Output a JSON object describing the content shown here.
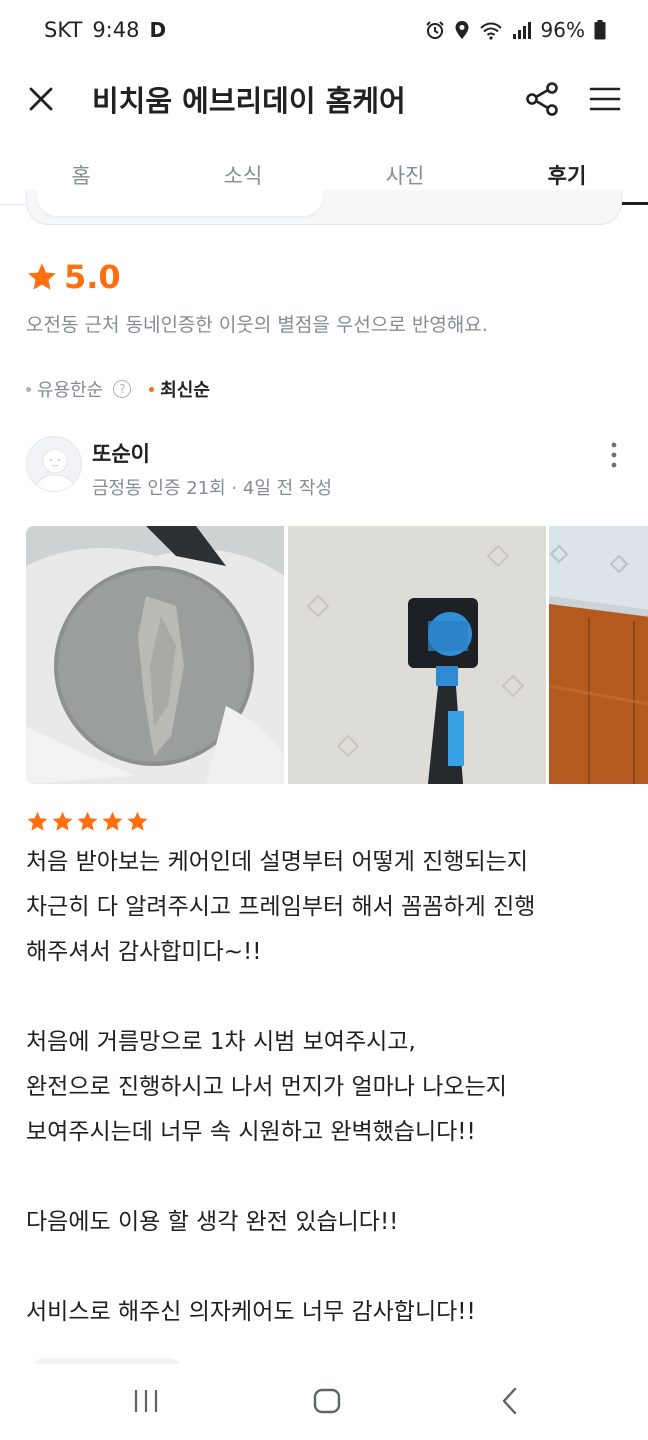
{
  "status_bar": {
    "carrier": "SKT",
    "time": "9:48",
    "app_icon_letter": "D",
    "battery": "96%"
  },
  "header": {
    "title": "비치움 에브리데이 홈케어"
  },
  "tabs": [
    {
      "label": "홈",
      "active": false
    },
    {
      "label": "소식",
      "active": false
    },
    {
      "label": "사진",
      "active": false
    },
    {
      "label": "후기",
      "active": true
    }
  ],
  "rating": {
    "value": "5.0",
    "note": "오전동 근처 동네인증한 이웃의 별점을 우선으로 반영해요."
  },
  "sort": {
    "helpful": "유용한순",
    "latest": "최신순",
    "help_glyph": "?"
  },
  "review": {
    "name": "또순이",
    "meta": "금정동 인증 21회 · 4일 전 작성",
    "stars": 5,
    "lines": [
      "처음 받아보는 케어인데 설명부터 어떻게 진행되는지",
      "차근히 다 알려주시고 프레임부터 해서 꼼꼼하게 진행",
      "해주셔서 감사합미다~!!",
      "",
      "처음에 거름망으로 1차 시범 보여주시고,",
      "완전으로 진행하시고 나서 먼지가 얼마나 나오는지",
      "보여주시는데 너무 속 시원하고 완벽했습니다!!",
      "",
      "다음에도 이용 할 생각 완전 있습니다!!",
      "",
      "서비스로 해주신 의자케어도 너무 감사합니다!!"
    ]
  },
  "colors": {
    "accent": "#ff6f0f",
    "text_primary": "#212124",
    "text_secondary": "#868b94"
  },
  "icons": {
    "close": "close-icon",
    "share": "share-icon",
    "menu": "hamburger-menu-icon",
    "more": "more-vertical-icon",
    "star": "star-icon",
    "help": "question-circle-icon",
    "nav_recents": "recents-icon",
    "nav_home": "home-icon",
    "nav_back": "back-icon"
  }
}
